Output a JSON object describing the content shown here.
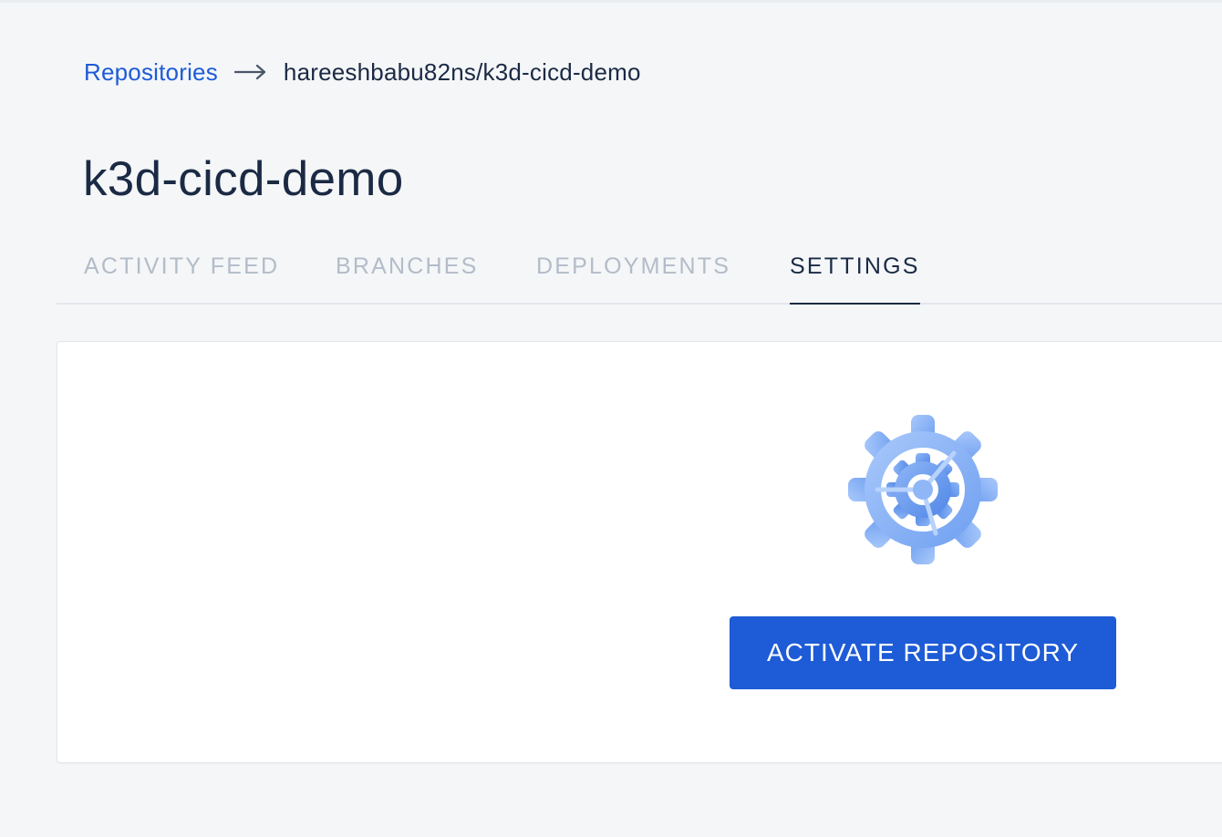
{
  "breadcrumb": {
    "root_label": "Repositories",
    "arrow_icon": "arrow-right-icon",
    "current_label": "hareeshbabu82ns/k3d-cicd-demo"
  },
  "page": {
    "title": "k3d-cicd-demo"
  },
  "tabs": [
    {
      "label": "ACTIVITY FEED",
      "active": false
    },
    {
      "label": "BRANCHES",
      "active": false
    },
    {
      "label": "DEPLOYMENTS",
      "active": false
    },
    {
      "label": "SETTINGS",
      "active": true
    }
  ],
  "card": {
    "illustration_icon": "gear-settings-icon",
    "activate_button_label": "ACTIVATE REPOSITORY"
  },
  "colors": {
    "accent": "#1e5bd6",
    "text_dark": "#1b2a44",
    "tab_inactive": "#b3bcc8",
    "background": "#f4f6f8"
  }
}
